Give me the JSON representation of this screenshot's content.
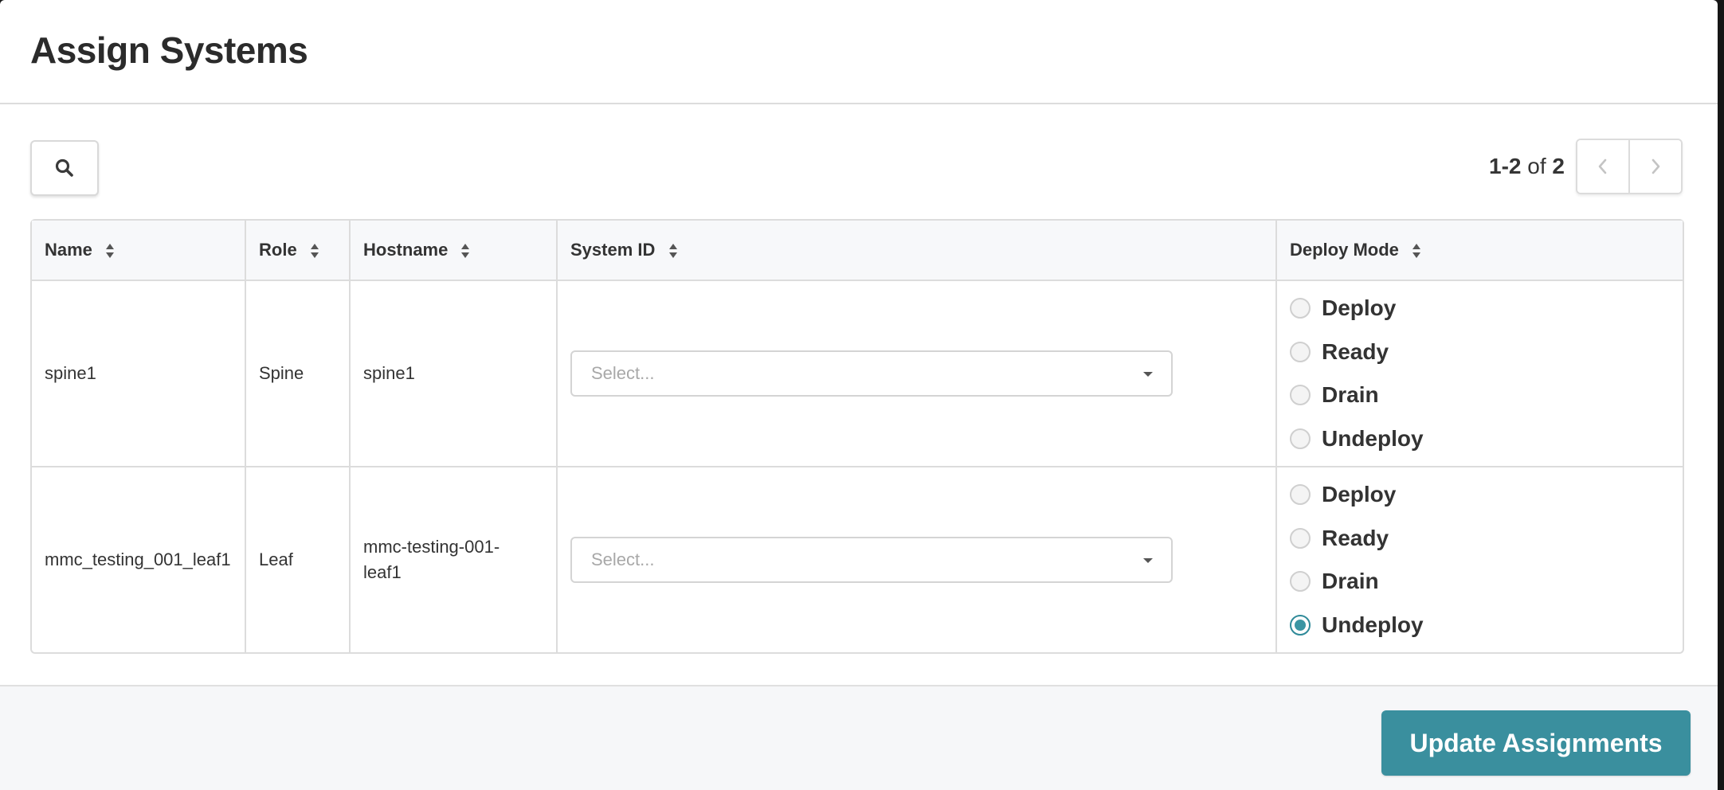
{
  "modal": {
    "title": "Assign Systems"
  },
  "toolbar": {
    "search_icon": "search-icon",
    "pagination": {
      "range": "1-2",
      "of": "of",
      "total": "2",
      "prev_icon": "chevron-left-icon",
      "next_icon": "chevron-right-icon"
    }
  },
  "table": {
    "columns": [
      {
        "label": "Name"
      },
      {
        "label": "Role"
      },
      {
        "label": "Hostname"
      },
      {
        "label": "System ID"
      },
      {
        "label": "Deploy Mode"
      }
    ],
    "rows": [
      {
        "name": "spine1",
        "role": "Spine",
        "hostname": "spine1",
        "system_id_placeholder": "Select...",
        "deploy_options": [
          "Deploy",
          "Ready",
          "Drain",
          "Undeploy"
        ],
        "deploy_selected": null
      },
      {
        "name": "mmc_testing_001_leaf1",
        "role": "Leaf",
        "hostname_line1": "mmc-testing-001-",
        "hostname_line2": "leaf1",
        "system_id_placeholder": "Select...",
        "deploy_options": [
          "Deploy",
          "Ready",
          "Drain",
          "Undeploy"
        ],
        "deploy_selected": "Undeploy"
      }
    ]
  },
  "footer": {
    "update_label": "Update Assignments"
  },
  "colors": {
    "accent": "#3a8f9e",
    "border": "#dcdcdc",
    "header_bg": "#f7f8fa",
    "footer_bg": "#f6f7f9"
  }
}
